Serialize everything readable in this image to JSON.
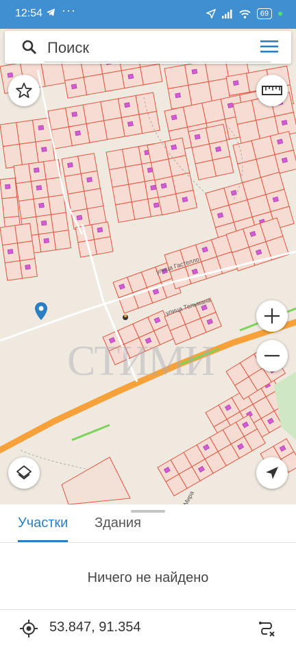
{
  "status": {
    "time": "12:54",
    "battery": "69"
  },
  "search": {
    "placeholder": "Поиск"
  },
  "map": {
    "watermark": "СТИМИ",
    "streets": [
      "улица Гастелло",
      "улица Тельмана",
      "Мира"
    ]
  },
  "icons": {
    "search": "search-icon",
    "menu": "hamburger-menu-icon",
    "star": "star-icon",
    "ruler": "ruler-icon",
    "layers": "layers-icon",
    "navigate": "navigation-arrow-icon",
    "zoom_in": "plus-icon",
    "zoom_out": "minus-icon",
    "pin": "map-pin-icon",
    "target": "crosshair-target-icon",
    "route": "route-icon"
  },
  "colors": {
    "accent": "#2a7fc4",
    "statusbar": "#3f8fd1",
    "parcel": "#e0553f",
    "building": "#d25bd6",
    "highway": "#f6a13a"
  },
  "panel": {
    "tabs": [
      {
        "label": "Участки",
        "active": true
      },
      {
        "label": "Здания",
        "active": false
      }
    ],
    "empty_message": "Ничего не найдено",
    "coordinates": "53.847, 91.354"
  }
}
